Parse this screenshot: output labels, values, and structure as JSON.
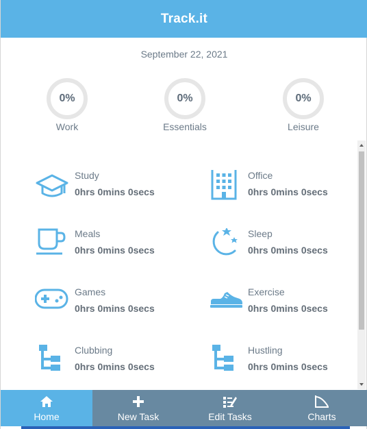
{
  "header": {
    "title": "Track.it"
  },
  "date": "September 22, 2021",
  "summary": [
    {
      "label": "Work",
      "percent": "0%"
    },
    {
      "label": "Essentials",
      "percent": "0%"
    },
    {
      "label": "Leisure",
      "percent": "0%"
    }
  ],
  "activities": [
    {
      "name": "Study",
      "time": "0hrs 0mins 0secs",
      "icon": "graduation-cap-icon"
    },
    {
      "name": "Office",
      "time": "0hrs 0mins 0secs",
      "icon": "office-building-icon"
    },
    {
      "name": "Meals",
      "time": "0hrs 0mins 0secs",
      "icon": "coffee-cup-icon"
    },
    {
      "name": "Sleep",
      "time": "0hrs 0mins 0secs",
      "icon": "moon-stars-icon"
    },
    {
      "name": "Games",
      "time": "0hrs 0mins 0secs",
      "icon": "gamepad-icon"
    },
    {
      "name": "Exercise",
      "time": "0hrs 0mins 0secs",
      "icon": "sneaker-icon"
    },
    {
      "name": "Clubbing",
      "time": "0hrs 0mins 0secs",
      "icon": "tree-structure-icon"
    },
    {
      "name": "Hustling",
      "time": "0hrs 0mins 0secs",
      "icon": "tree-structure-icon"
    }
  ],
  "nav": [
    {
      "label": "Home",
      "icon": "home-icon",
      "active": true
    },
    {
      "label": "New Task",
      "icon": "plus-icon",
      "active": false
    },
    {
      "label": "Edit Tasks",
      "icon": "edit-icon",
      "active": false
    },
    {
      "label": "Charts",
      "icon": "chart-icon",
      "active": false
    }
  ],
  "colors": {
    "accent": "#5ab3e6",
    "nav": "#6889a1",
    "icon": "#5ab3e6",
    "text": "#6b7a88"
  }
}
